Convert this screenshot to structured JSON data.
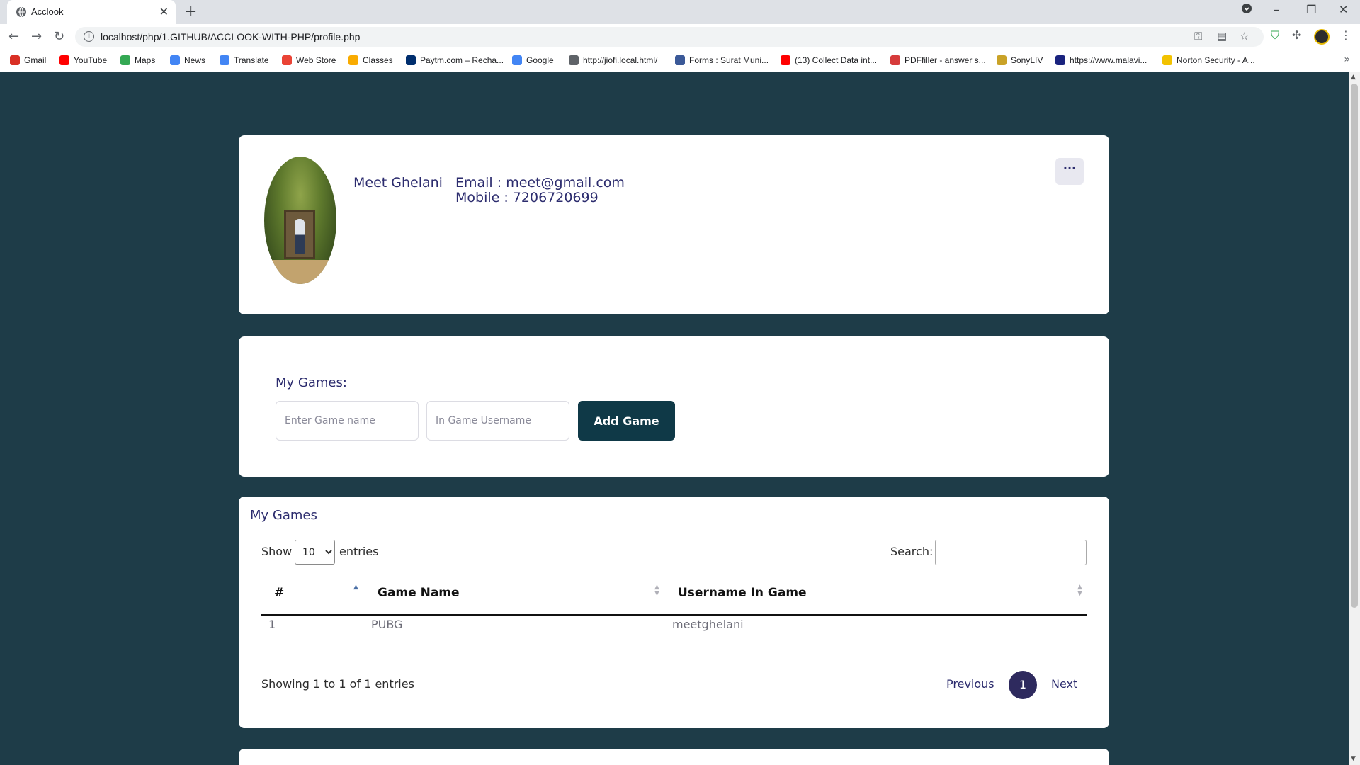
{
  "browser": {
    "tab_title": "Acclook",
    "tab_close": "✕",
    "new_tab": "+",
    "url": "localhost/php/1.GITHUB/ACCLOOK-WITH-PHP/profile.php",
    "nav": {
      "back": "←",
      "forward": "→",
      "reload": "↻"
    },
    "window": {
      "minimize": "–",
      "restore": "❐",
      "close": "✕"
    },
    "bookmarks": [
      {
        "label": "Gmail",
        "icon": "gmail-icon",
        "color": "#d93025"
      },
      {
        "label": "YouTube",
        "icon": "youtube-icon",
        "color": "#ff0000"
      },
      {
        "label": "Maps",
        "icon": "maps-icon",
        "color": "#34a853"
      },
      {
        "label": "News",
        "icon": "news-icon",
        "color": "#4285f4"
      },
      {
        "label": "Translate",
        "icon": "translate-icon",
        "color": "#4285f4"
      },
      {
        "label": "Web Store",
        "icon": "web-store-icon",
        "color": "#ea4335"
      },
      {
        "label": "Classes",
        "icon": "classes-icon",
        "color": "#f9ab00"
      },
      {
        "label": "Paytm.com – Recha...",
        "icon": "paytm-icon",
        "color": "#002e6e"
      },
      {
        "label": "Google",
        "icon": "google-icon",
        "color": "#4285f4"
      },
      {
        "label": "http://jiofi.local.html/",
        "icon": "globe-icon",
        "color": "#5f6368"
      },
      {
        "label": "Forms : Surat Muni...",
        "icon": "forms-icon",
        "color": "#3b5998"
      },
      {
        "label": "(13) Collect Data int...",
        "icon": "youtube-icon",
        "color": "#ff0000"
      },
      {
        "label": "PDFfiller - answer s...",
        "icon": "pdffiller-icon",
        "color": "#d63b3b"
      },
      {
        "label": "SonyLIV",
        "icon": "sonyliv-icon",
        "color": "#c9a227"
      },
      {
        "label": "https://www.malavi...",
        "icon": "malavi-icon",
        "color": "#1a237e"
      },
      {
        "label": "Norton Security - A...",
        "icon": "norton-icon",
        "color": "#f2c200"
      }
    ],
    "bookmarks_more": "»"
  },
  "profile": {
    "name": "Meet Ghelani",
    "email_line": "Email : meet@gmail.com",
    "mobile_line": "Mobile : 7206720699",
    "more_button": "···"
  },
  "add_game": {
    "heading": "My Games:",
    "game_name_placeholder": "Enter Game name",
    "username_placeholder": "In Game Username",
    "button_label": "Add Game"
  },
  "games_table": {
    "title": "My Games",
    "show_label": "Show",
    "entries_value": "10",
    "entries_label": "entries",
    "search_label": "Search:",
    "columns": [
      "#",
      "Game Name",
      "Username In Game"
    ],
    "rows": [
      [
        "1",
        "PUBG",
        "meetghelani"
      ]
    ],
    "info": "Showing 1 to 1 of 1 entries",
    "pagination": {
      "previous": "Previous",
      "current": "1",
      "next": "Next"
    }
  },
  "colors": {
    "page_background": "#1e3c48",
    "primary_button": "#0f3947",
    "accent_text": "#2c2c6e",
    "pager_active": "#2e2a5e"
  }
}
